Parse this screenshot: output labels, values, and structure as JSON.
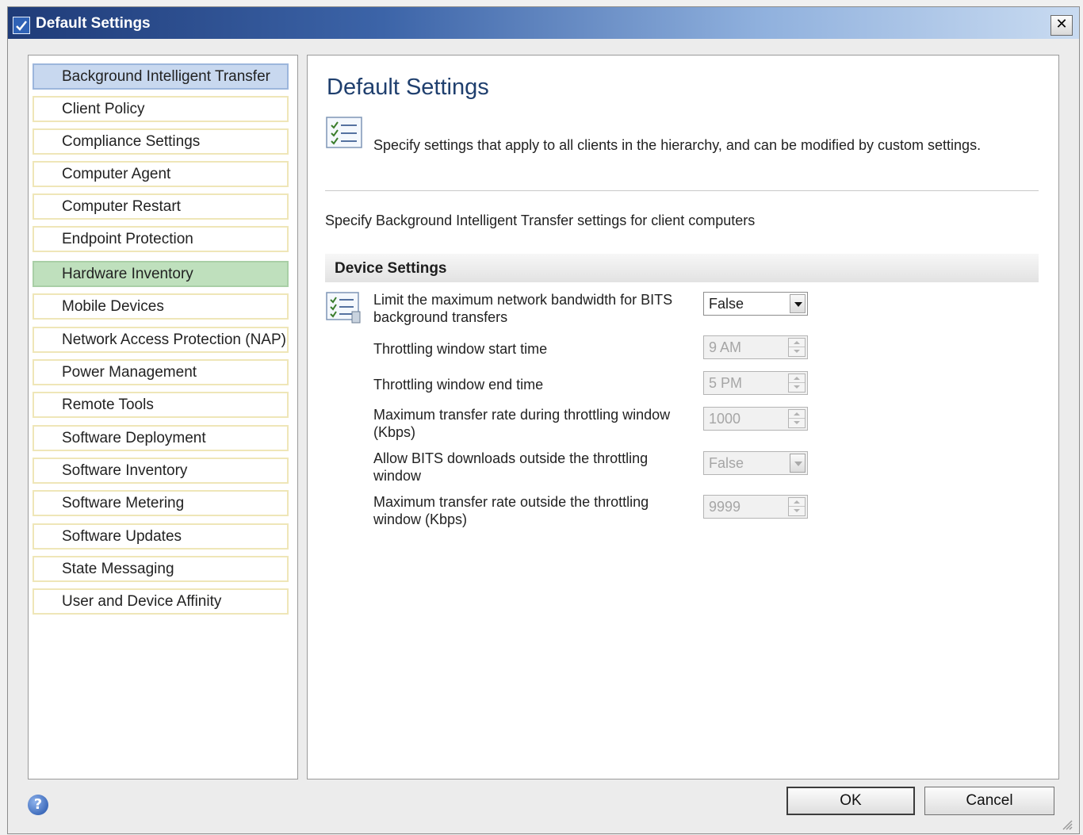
{
  "window": {
    "title": "Default Settings",
    "close_label": "✕"
  },
  "sidebar": {
    "items": [
      {
        "label": "Background Intelligent Transfer",
        "state": "selected"
      },
      {
        "label": "Client Policy"
      },
      {
        "label": "Compliance Settings"
      },
      {
        "label": "Computer Agent"
      },
      {
        "label": "Computer Restart"
      },
      {
        "label": "Endpoint Protection"
      },
      {
        "label": "Hardware Inventory",
        "state": "highlighted"
      },
      {
        "label": "Mobile Devices"
      },
      {
        "label": "Network Access Protection (NAP)"
      },
      {
        "label": "Power Management"
      },
      {
        "label": "Remote Tools"
      },
      {
        "label": "Software Deployment"
      },
      {
        "label": "Software Inventory"
      },
      {
        "label": "Software Metering"
      },
      {
        "label": "Software Updates"
      },
      {
        "label": "State Messaging"
      },
      {
        "label": "User and Device Affinity"
      }
    ]
  },
  "main": {
    "heading": "Default Settings",
    "description": "Specify settings that apply to all clients in the hierarchy, and can be modified by custom settings.",
    "subdescription": "Specify Background Intelligent Transfer settings for client computers",
    "section_title": "Device Settings",
    "settings": [
      {
        "label": "Limit the maximum network bandwidth for BITS background transfers",
        "control": "dropdown",
        "value": "False",
        "enabled": true
      },
      {
        "label": "Throttling window start time",
        "control": "spinner",
        "value": "9 AM",
        "enabled": false
      },
      {
        "label": "Throttling window end time",
        "control": "spinner",
        "value": "5 PM",
        "enabled": false
      },
      {
        "label": "Maximum transfer rate during throttling window (Kbps)",
        "control": "spinner",
        "value": "1000",
        "enabled": false
      },
      {
        "label": "Allow BITS downloads outside the throttling window",
        "control": "dropdown",
        "value": "False",
        "enabled": false
      },
      {
        "label": "Maximum transfer rate outside the throttling window (Kbps)",
        "control": "spinner",
        "value": "9999",
        "enabled": false
      }
    ]
  },
  "footer": {
    "help_label": "?",
    "ok_label": "OK",
    "cancel_label": "Cancel"
  },
  "icons": [
    "app-icon",
    "close-icon",
    "checklist-icon",
    "settings-checklist-icon",
    "help-icon",
    "resize-grip-icon"
  ],
  "colors": {
    "title_gradient_start": "#1f3b78",
    "selected_item": "#c8d8ef",
    "highlighted_item": "#bfe0bd",
    "heading_text": "#1f3f6e"
  }
}
